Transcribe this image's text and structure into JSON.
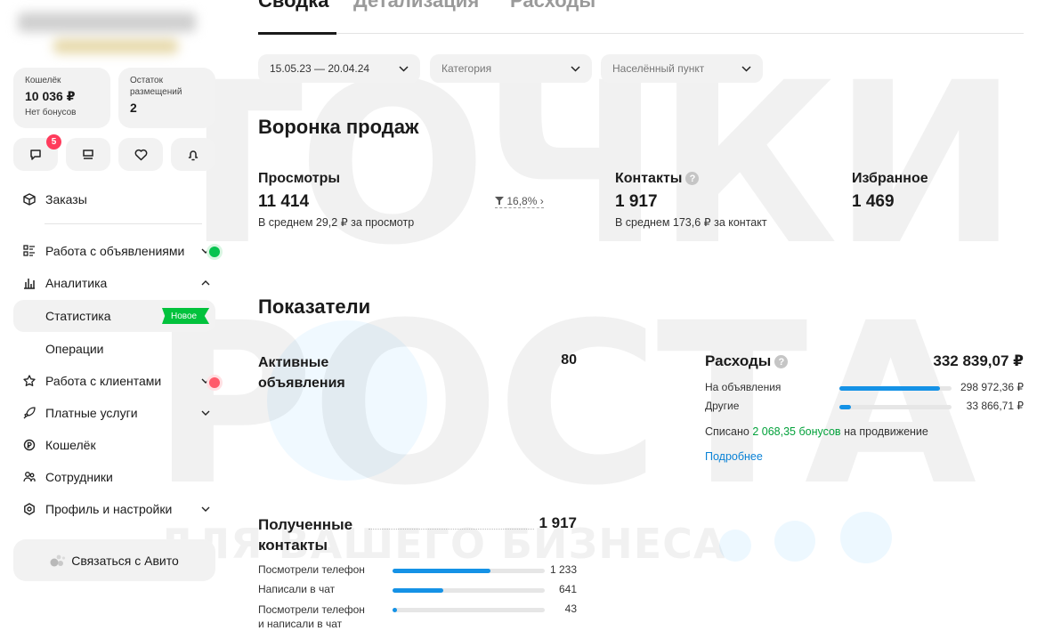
{
  "watermark": {
    "line1": "ТОЧКИ",
    "line2": "РОСТА",
    "line3": "ДЛЯ ВАШЕГО БИЗНЕСА"
  },
  "sidebar": {
    "wallet": {
      "label": "Кошелёк",
      "amount": "10 036 ₽",
      "bonus": "Нет бонусов"
    },
    "remaining": {
      "label": "Остаток размещений",
      "value": "2"
    },
    "icons": [
      {
        "name": "messages-icon",
        "badge": "5"
      },
      {
        "name": "notes-icon"
      },
      {
        "name": "favorites-icon"
      },
      {
        "name": "notifications-icon"
      }
    ],
    "items": [
      {
        "label": "Заказы",
        "icon": "box-icon"
      },
      {
        "label": "Работа с объявлениями",
        "icon": "list-icon"
      },
      {
        "label": "Аналитика",
        "icon": "chart-icon"
      },
      {
        "label": "Статистика",
        "badge": "Новое"
      },
      {
        "label": "Операции"
      },
      {
        "label": "Работа с клиентами",
        "icon": "star-icon"
      },
      {
        "label": "Платные услуги",
        "icon": "rocket-icon"
      },
      {
        "label": "Кошелёк",
        "icon": "wallet-icon"
      },
      {
        "label": "Сотрудники",
        "icon": "people-icon"
      },
      {
        "label": "Профиль и настройки",
        "icon": "settings-icon"
      }
    ],
    "contact_button": "Связаться с Авито"
  },
  "tabs": [
    "Сводка",
    "Детализация",
    "Расходы"
  ],
  "filters": {
    "date": "15.05.23 — 20.04.24",
    "category": "Категория",
    "city": "Населённый пункт"
  },
  "funnel": {
    "title": "Воронка продаж",
    "views": {
      "label": "Просмотры",
      "value": "11 414",
      "note": "В среднем 29,2 ₽ за просмотр"
    },
    "conversion": "16,8%",
    "contacts": {
      "label": "Контакты",
      "value": "1 917",
      "note": "В среднем 173,6 ₽ за контакт"
    },
    "favorites": {
      "label": "Избранное",
      "value": "1 469"
    }
  },
  "indicators": {
    "title": "Показатели",
    "active_ads": {
      "label_line1": "Активные",
      "label_line2": "объявления",
      "value": "80"
    },
    "expenses": {
      "label": "Расходы",
      "total": "332 839,07 ₽",
      "rows": [
        {
          "label": "На объявления",
          "value": "298 972,36 ₽",
          "share": 0.9
        },
        {
          "label": "Другие",
          "value": "33 866,71 ₽",
          "share": 0.1
        }
      ],
      "spent_prefix": "Списано",
      "spent_bonus": "2 068,35 бонусов",
      "spent_suffix": "на продвижение",
      "more": "Подробнее"
    },
    "received": {
      "label_line1": "Полученные",
      "label_line2": "контакты",
      "value": "1 917",
      "rows": [
        {
          "label": "Посмотрели телефон",
          "value": "1 233",
          "share": 0.643
        },
        {
          "label": "Написали в чат",
          "value": "641",
          "share": 0.334
        },
        {
          "label_line1": "Посмотрели телефон",
          "label_line2": "и написали в чат",
          "value": "43",
          "share": 0.022
        }
      ]
    }
  },
  "colors": {
    "accent": "#1592e6",
    "new_badge": "#02c23d",
    "badge_red": "#ff3b5c",
    "link": "#0a82d6"
  }
}
